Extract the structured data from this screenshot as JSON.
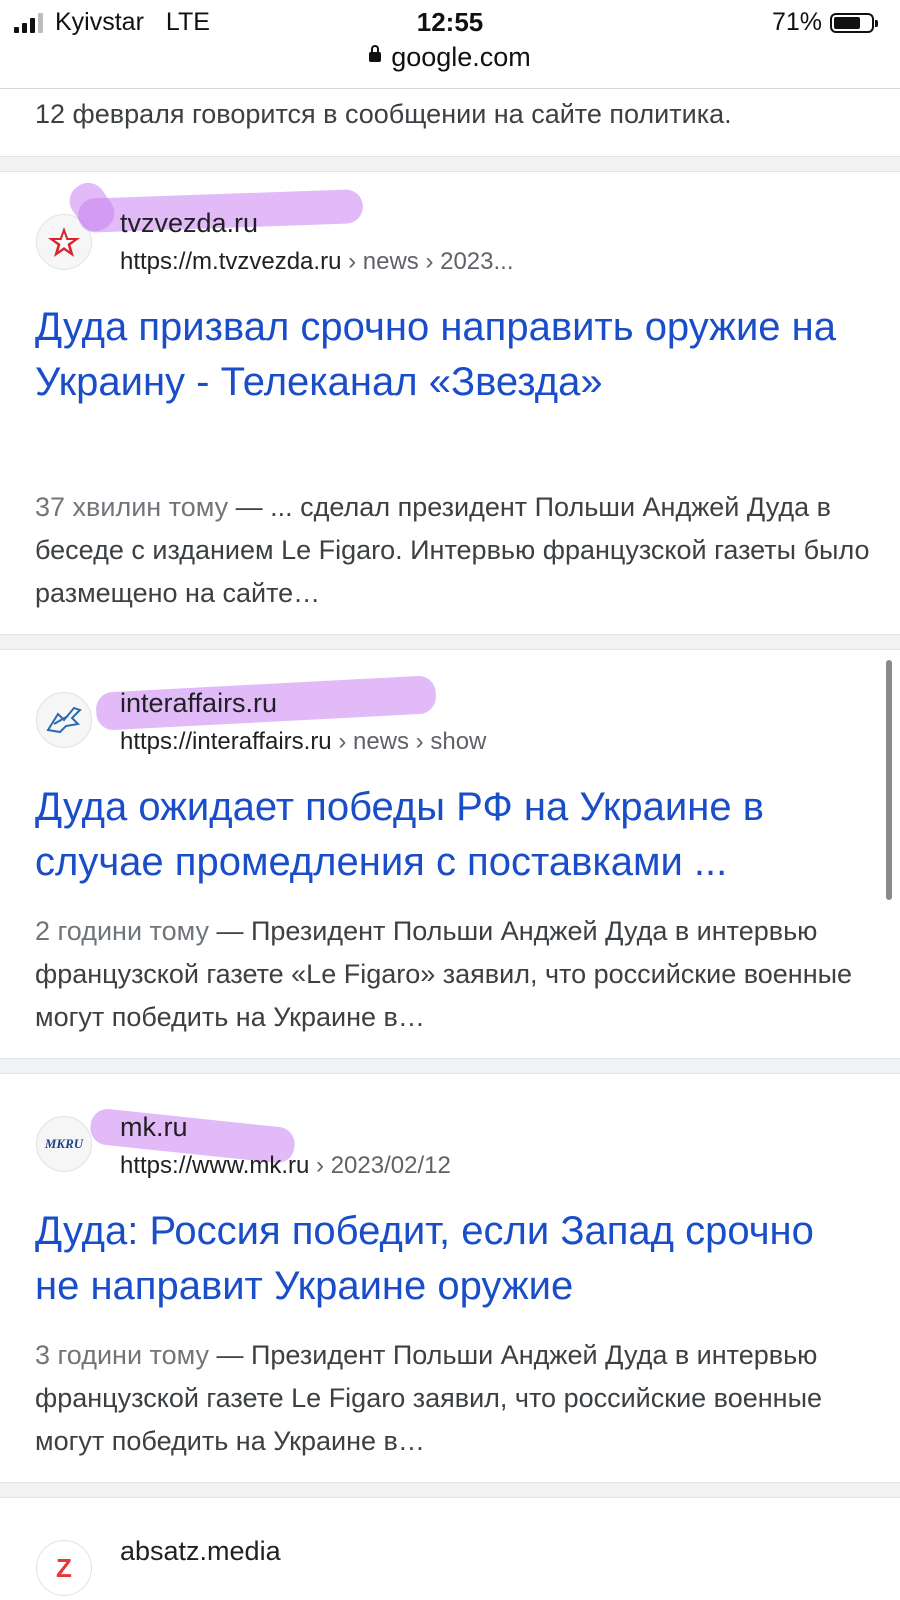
{
  "status": {
    "carrier": "Kyivstar",
    "network": "LTE",
    "time": "12:55",
    "battery": "71%",
    "url": "google.com"
  },
  "top_snippet": "12 февраля говорится в сообщении на сайте политика.",
  "results": [
    {
      "site": "tvzvezda.ru",
      "url": "https://m.tvzvezda.ru",
      "path": " › news › 2023...",
      "title": "Дуда призвал срочно направить оружие на Украину - Телеканал «Звезда»",
      "time": "37 хвилин тому",
      "snippet": "— ... сделал президент Польши Анджей Дуда в беседе с изданием Le Figaro. Интервью французской газеты было размещено на сайте…",
      "favicon": "red-star-icon"
    },
    {
      "site": "interaffairs.ru",
      "url": "https://interaffairs.ru",
      "path": " › news › show",
      "title": "Дуда ожидает победы РФ на Украине в случае промедления с поставками ...",
      "time": "2 години тому",
      "snippet": "— Президент Польши Анджей Дуда в интервью французской газете «Le Figaro» заявил, что российские военные могут победить на Украине в…",
      "favicon": "griffin-logo-icon"
    },
    {
      "site": "mk.ru",
      "url": "https://www.mk.ru",
      "path": " › 2023/02/12",
      "title": "Дуда: Россия победит, если Запад срочно не направит Украине оружие",
      "time": "3 години тому",
      "snippet": "— Президент Польши Анджей Дуда в интервью французской газете Le Figaro заявил, что российские военные могут победить на Украине в…",
      "favicon": "mk-logo-icon",
      "favicon_text": "MKRU"
    },
    {
      "site": "absatz.media",
      "favicon": "absatz-logo-icon",
      "favicon_text": "Z"
    }
  ]
}
